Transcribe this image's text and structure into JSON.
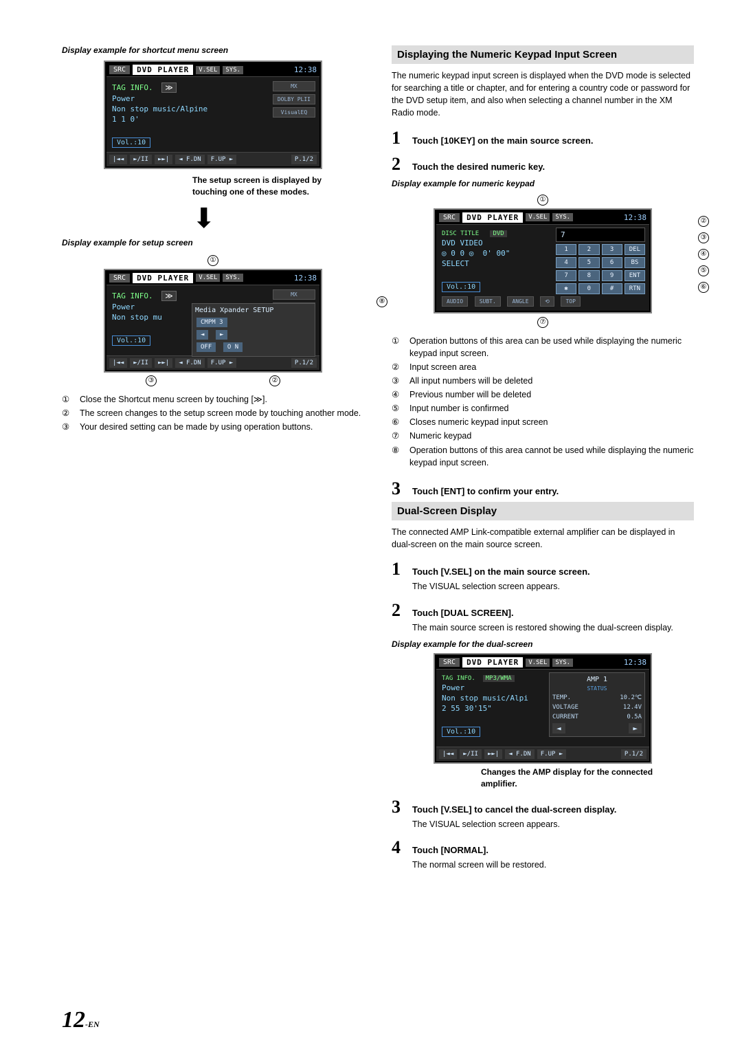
{
  "left": {
    "caption_shortcut": "Display example for shortcut menu screen",
    "caption_setup": "Display example for setup screen",
    "note_setup": "The setup screen is displayed by touching one of these modes.",
    "lcd_common": {
      "src": "SRC",
      "title": "DVD PLAYER",
      "badge1": "V.SEL",
      "badge2": "SYS.",
      "time": "12:38",
      "tag_info": "TAG INFO.",
      "power": "Power",
      "track": "Non stop music/Alpine",
      "row_icons": "1     1     0'",
      "vol": "Vol.:10",
      "btn_prev": "|◄◄",
      "btn_play": "►/II",
      "btn_next": "►►|",
      "btn_fdn": "◄ F.DN",
      "btn_fup": "F.UP ►",
      "btn_p12": "P.1/2",
      "chip_mx": "MX",
      "chip_dolby": "DOLBY PLII",
      "chip_visual": "VisualEQ",
      "dbl": "≫"
    },
    "setup_panel": {
      "title": "Media Xpander SETUP",
      "mode": "CMPM 3",
      "off": "OFF",
      "on": "O N",
      "track_short": "Non stop mu"
    },
    "callout_top": "①",
    "callout_b1": "③",
    "callout_b2": "②",
    "enum": [
      {
        "n": "①",
        "t": "Close the Shortcut menu screen by touching [≫]."
      },
      {
        "n": "②",
        "t": "The screen changes to the setup screen mode by touching another mode."
      },
      {
        "n": "③",
        "t": "Your desired setting can be made by using operation buttons."
      }
    ]
  },
  "right": {
    "h_numeric": "Displaying the Numeric Keypad Input Screen",
    "p_numeric": "The numeric keypad input screen is displayed when the DVD mode is selected for searching a title or chapter, and for entering a country code or password for the DVD setup item, and also when selecting a channel number in the XM Radio mode.",
    "step1": "Touch [10KEY] on the main source screen.",
    "step2": "Touch the desired numeric key.",
    "caption_keypad": "Display example for numeric keypad",
    "keypad_lcd": {
      "disc_title": "DISC TITLE",
      "dvd_badge": "DVD",
      "dvd_video": "DVD VIDEO",
      "counter": "0' 00\"",
      "row_disc": "◎ 0   0 ◎",
      "select": "SELECT",
      "audio": "AUDIO",
      "subt": "SUBT.",
      "angle": "ANGLE",
      "ret": "⟲",
      "top": "TOP",
      "big7": "7",
      "k1": "1",
      "k2": "2",
      "k3": "3",
      "kdel": "DEL",
      "k4": "4",
      "k5": "5",
      "k6": "6",
      "kbs": "BS",
      "k7": "7",
      "k8": "8",
      "k9": "9",
      "kent": "ENT",
      "kx": "✱",
      "k0": "0",
      "kh": "#",
      "krtn": "RTN"
    },
    "callouts": {
      "c1": "①",
      "c2": "②",
      "c3": "③",
      "c4": "④",
      "c5": "⑤",
      "c6": "⑥",
      "c7": "⑦",
      "c8": "⑧"
    },
    "enum_keypad": [
      {
        "n": "①",
        "t": "Operation buttons of this area can be used while displaying the numeric keypad input screen."
      },
      {
        "n": "②",
        "t": "Input screen area"
      },
      {
        "n": "③",
        "t": "All input numbers will be deleted"
      },
      {
        "n": "④",
        "t": "Previous number will be deleted"
      },
      {
        "n": "⑤",
        "t": "Input number is confirmed"
      },
      {
        "n": "⑥",
        "t": "Closes numeric keypad input screen"
      },
      {
        "n": "⑦",
        "t": "Numeric keypad"
      },
      {
        "n": "⑧",
        "t": "Operation buttons of this area cannot be used while displaying the numeric keypad input screen."
      }
    ],
    "step3": "Touch [ENT] to confirm your entry.",
    "h_dual": "Dual-Screen Display",
    "p_dual": "The connected AMP Link-compatible external amplifier can be displayed in dual-screen on the main source screen.",
    "d_step1": "Touch [V.SEL] on the main source screen.",
    "d_step1_sub": "The VISUAL selection screen appears.",
    "d_step2": "Touch [DUAL SCREEN].",
    "d_step2_sub": "The main source screen is restored showing the dual-screen display.",
    "caption_dual": "Display example for the dual-screen",
    "dual_lcd": {
      "tag2": "MP3/WMA",
      "track": "Non stop music/Alpi",
      "row": "2   55   30'15\"",
      "amp_title": "AMP 1",
      "status": "STATUS",
      "t_lbl": "TEMP.",
      "t_val": "10.2℃",
      "v_lbl": "VOLTAGE",
      "v_val": "12.4V",
      "c_lbl": "CURRENT",
      "c_val": "0.5A",
      "p12": "P.1/2"
    },
    "dual_note": "Changes the AMP display for the connected amplifier.",
    "d_step3": "Touch [V.SEL] to cancel the dual-screen display.",
    "d_step3_sub": "The VISUAL selection screen appears.",
    "d_step4": "Touch [NORMAL].",
    "d_step4_sub": "The normal screen will be restored."
  },
  "page_number": "12",
  "page_suffix": "-EN"
}
